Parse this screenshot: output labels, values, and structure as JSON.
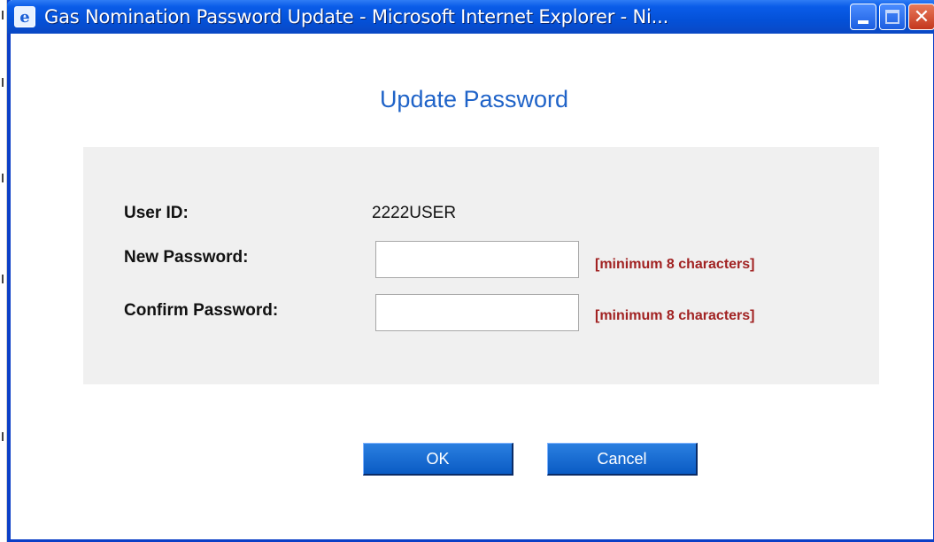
{
  "window": {
    "title": "Gas Nomination Password Update - Microsoft Internet Explorer - Ni...",
    "icon": "ie-icon",
    "controls": [
      "minimize-icon",
      "maximize-icon",
      "close-icon"
    ],
    "close_glyph": "✕"
  },
  "form": {
    "heading": "Update Password",
    "user_id_label": "User ID:",
    "user_id_value": "2222USER",
    "new_password_label": "New Password:",
    "new_password_value": "",
    "confirm_password_label": "Confirm Password:",
    "confirm_password_value": "",
    "new_password_hint": "[minimum 8 characters]",
    "confirm_password_hint": "[minimum 8 characters]"
  },
  "buttons": {
    "ok_label": "OK",
    "cancel_label": "Cancel"
  },
  "colors": {
    "heading": "#1f63c8",
    "hint": "#a12222",
    "button": "#0a5bc4",
    "panel": "#f0f0f0",
    "titlebar": "#0451d8"
  }
}
